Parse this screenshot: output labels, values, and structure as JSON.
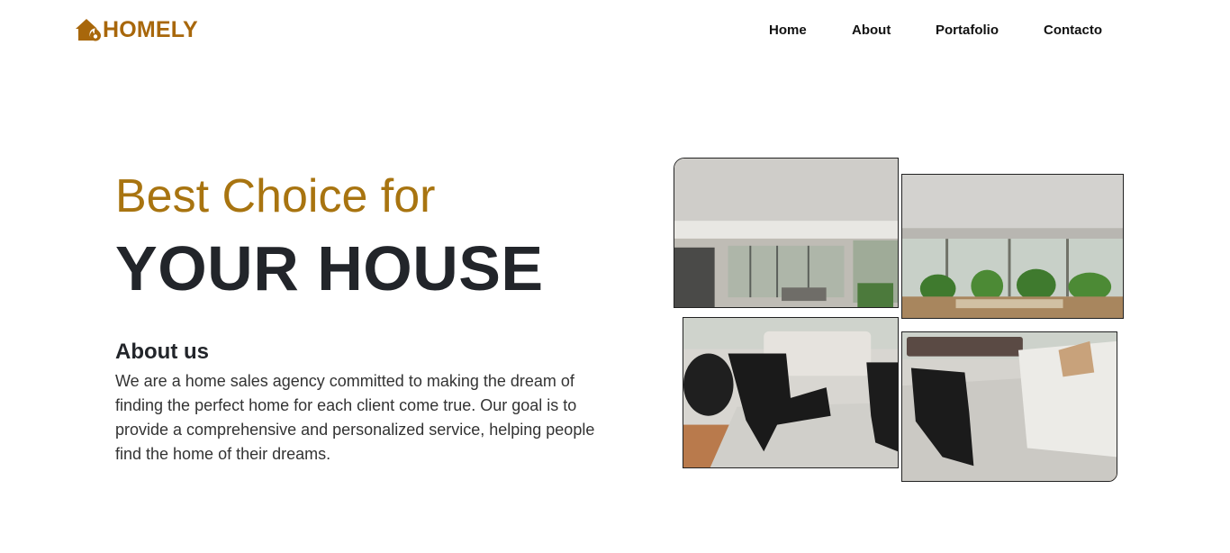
{
  "brand": {
    "name": "HOMELY",
    "icon": "house-fire-icon",
    "color": "#a8670b"
  },
  "nav": {
    "items": [
      {
        "label": "Home"
      },
      {
        "label": "About"
      },
      {
        "label": "Portafolio"
      },
      {
        "label": "Contacto"
      }
    ]
  },
  "hero": {
    "subtitle": "Best Choice for",
    "title": "YOUR HOUSE",
    "subtitle_color": "#a87410"
  },
  "about": {
    "heading": "About us",
    "text": "We are a home sales agency committed to making the dream of finding the perfect home for each client come true. Our goal is to provide a comprehensive and personalized service, helping people find the home of their dreams."
  },
  "gallery": {
    "images": [
      {
        "name": "living-room-interior-photo"
      },
      {
        "name": "patio-glass-wall-photo"
      },
      {
        "name": "lounge-chairs-photo"
      },
      {
        "name": "sofa-armchair-photo"
      }
    ]
  }
}
